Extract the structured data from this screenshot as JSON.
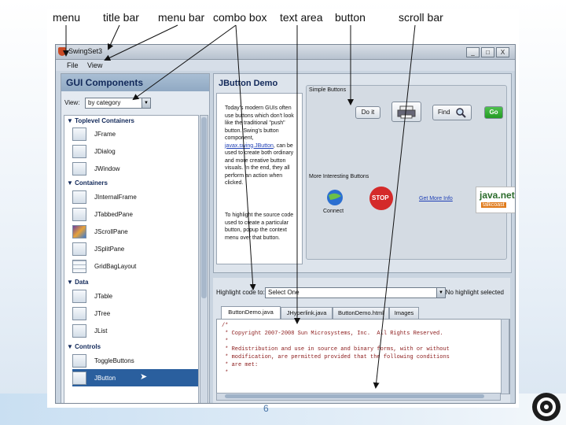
{
  "annotations": [
    "menu",
    "title bar",
    "menu bar",
    "combo box",
    "text area",
    "button",
    "scroll bar"
  ],
  "window": {
    "title": "SwingSet3",
    "controls": [
      "_",
      "□",
      "X"
    ],
    "menu": [
      "File",
      "View"
    ]
  },
  "left_panel": {
    "title": "GUI Components",
    "view_label": "View:",
    "view_selected": "by category",
    "groups": [
      {
        "name": "Toplevel Containers",
        "items": [
          "JFrame",
          "JDialog",
          "JWindow"
        ]
      },
      {
        "name": "Containers",
        "items": [
          "JInternalFrame",
          "JTabbedPane",
          "JScrollPane",
          "JSplitPane",
          "GridBagLayout"
        ]
      },
      {
        "name": "Data",
        "items": [
          "JTable",
          "JTree",
          "JList"
        ]
      },
      {
        "name": "Controls",
        "items": [
          "ToggleButtons",
          "JButton"
        ]
      }
    ],
    "selected_item": "JButton"
  },
  "demo": {
    "title": "JButton Demo",
    "description_1": "Today's modern GUIs often use buttons which don't look like the traditional \"push\" button. Swing's button component,",
    "description_link": "javax.swing.JButton",
    "description_2": ", can be used to create both ordinary and more creative button visuals. In the end, they all perform an action when clicked.",
    "description_3": "To highlight the source code used to create a particular button, popup the context menu over that button.",
    "simple_section": "Simple Buttons",
    "interesting_section": "More Interesting Buttons",
    "do_it": "Do it",
    "find": "Find",
    "go": "Go",
    "connect": "Connect",
    "stop": "STOP",
    "get_more_info": "Get More Info",
    "java_net": "java.net",
    "java_net_tag": "talkcoast"
  },
  "bottom": {
    "highlight_label": "Highlight code to:",
    "highlight_selected": "Select One",
    "no_highlight": "No highlight selected",
    "tabs": [
      "ButtonDemo.java",
      "JHyperlink.java",
      "ButtonDemo.html",
      "Images"
    ],
    "code_lines": [
      "/*",
      " * Copyright 2007-2008 Sun Microsystems, Inc.  All Rights Reserved.",
      " *",
      " * Redistribution and use in source and binary forms, with or without",
      " * modification, are permitted provided that the following conditions",
      " * are met:",
      " *"
    ]
  },
  "slide_number": "6",
  "colors": {
    "accent": "#2a5f9e",
    "go_green": "#2fae2f",
    "stop_red": "#d42a2a",
    "link_blue": "#1e3fb5"
  }
}
